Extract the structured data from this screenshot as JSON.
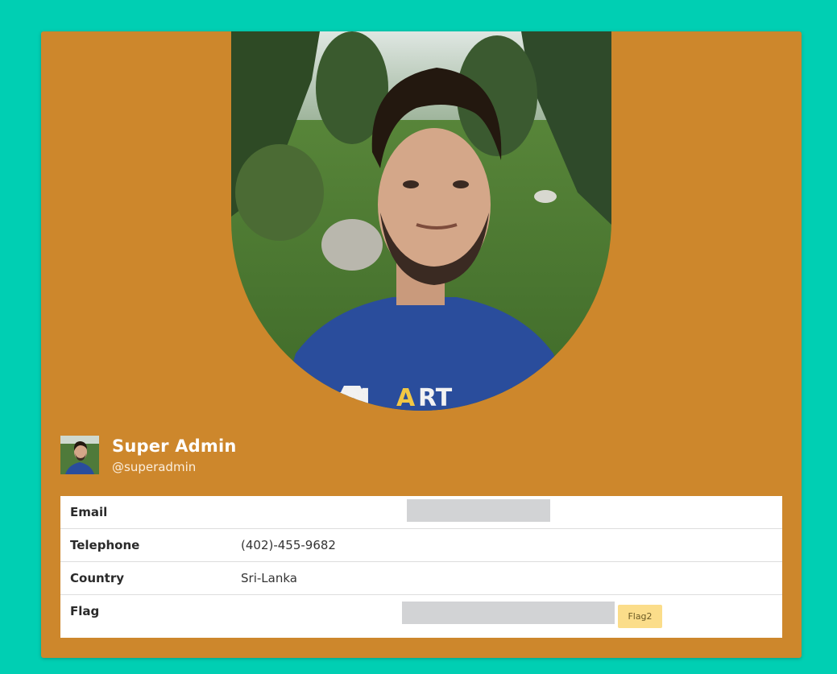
{
  "profile": {
    "full_name": "Super Admin",
    "username": "@superadmin",
    "cover_alt": "profile-cover-photo",
    "avatar_alt": "profile-avatar"
  },
  "details": {
    "email_label": "Email",
    "email_value": "",
    "telephone_label": "Telephone",
    "telephone_value": "(402)-455-9682",
    "country_label": "Country",
    "country_value": "Sri-Lanka",
    "flag_label": "Flag",
    "flag_badge": "Flag2"
  },
  "colors": {
    "page_background": "#00cfb3",
    "card_background": "#cd872c",
    "badge_background": "#fbdd8a",
    "redaction": "#d2d3d5"
  }
}
